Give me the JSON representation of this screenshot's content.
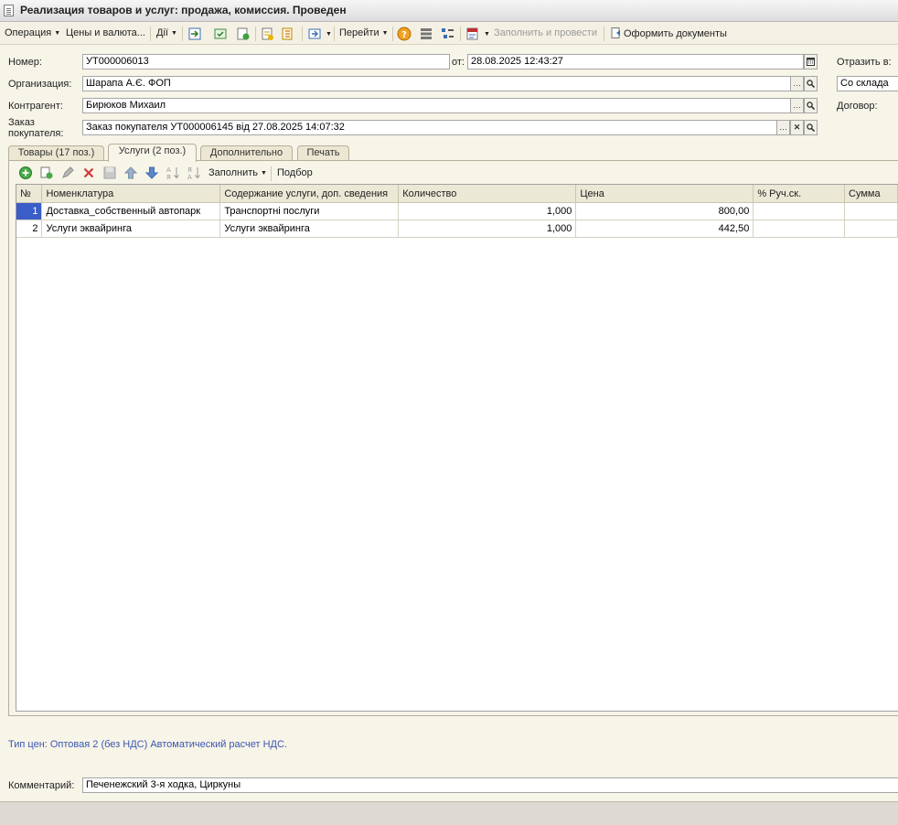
{
  "window": {
    "title": "Реализация товаров и услуг: продажа, комиссия. Проведен"
  },
  "toolbar": {
    "operation": "Операция",
    "prices": "Цены и валюта...",
    "actions": "Дії",
    "go_to": "Перейти",
    "fill_and_post": "Заполнить и провести",
    "make_docs": "Оформить документы"
  },
  "header": {
    "number_label": "Номер:",
    "number_value": "УТ000006013",
    "date_label": "от:",
    "date_value": "28.08.2025 12:43:27",
    "reflect_label": "Отразить в:",
    "org_label": "Организация:",
    "org_value": "Шарапа А.Є. ФОП",
    "warehouse_value": "Со склада",
    "counterparty_label": "Контрагент:",
    "counterparty_value": "Бирюков Михаил",
    "contract_label": "Договор:",
    "order_label_1": "Заказ",
    "order_label_2": "покупателя:",
    "order_value": "Заказ покупателя УТ000006145 від 27.08.2025 14:07:32"
  },
  "tabs": [
    {
      "label": "Товары (17 поз.)"
    },
    {
      "label": "Услуги (2 поз.)"
    },
    {
      "label": "Дополнительно"
    },
    {
      "label": "Печать"
    }
  ],
  "subtoolbar": {
    "fill": "Заполнить",
    "selection": "Подбор"
  },
  "table": {
    "columns": [
      "№",
      "Номенклатура",
      "Содержание услуги, доп. сведения",
      "Количество",
      "Цена",
      "% Руч.ск.",
      "Сумма"
    ],
    "rows": [
      {
        "no": "1",
        "item": "Доставка_собственный автопарк",
        "content": "Транспортні послуги",
        "qty": "1,000",
        "price": "800,00",
        "disc": "",
        "sum": ""
      },
      {
        "no": "2",
        "item": "Услуги эквайринга",
        "content": "Услуги эквайринга",
        "qty": "1,000",
        "price": "442,50",
        "disc": "",
        "sum": ""
      }
    ]
  },
  "footer": {
    "price_type_note": "Тип цен: Оптовая 2 (без НДС) Автоматический расчет НДС.",
    "comment_label": "Комментарий:",
    "comment_value": "Печенежский 3-я ходка, Циркуны"
  },
  "colors": {
    "accent": "#3a5dc8",
    "note": "#3a57b0",
    "background": "#f7f4e8"
  }
}
